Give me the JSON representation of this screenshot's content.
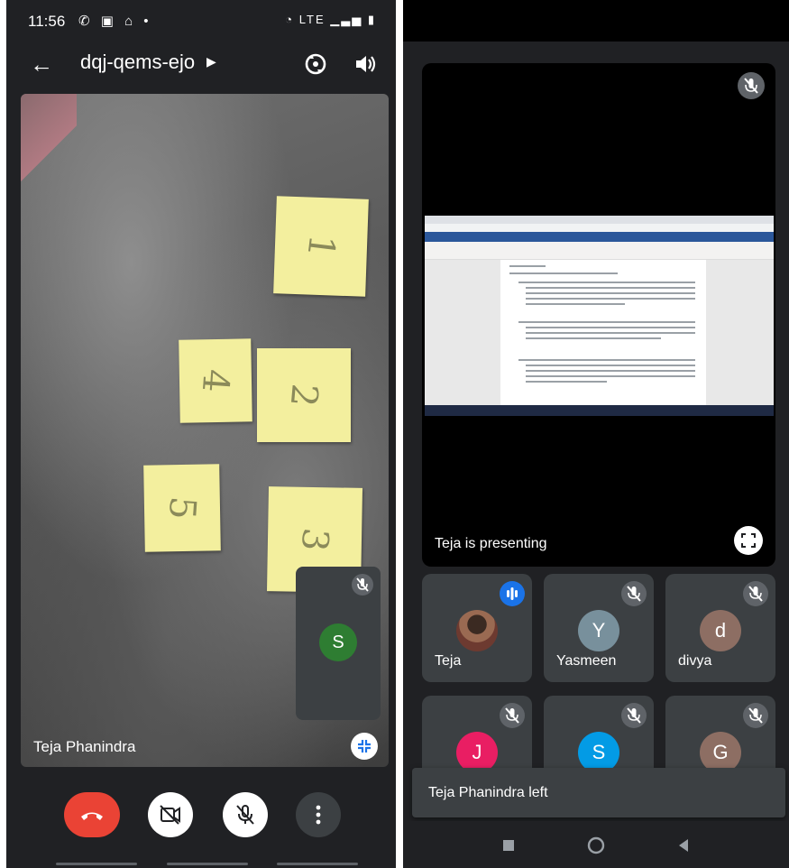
{
  "status_bar": {
    "time": "11:56",
    "icons_left": "✆ ▣ ⌂ •",
    "icons_right": "◔ LTE ▁▃▅ ▮"
  },
  "meeting": {
    "code": "dqj-qems-ejo"
  },
  "main_video": {
    "participant": "Teja Phanindra",
    "notes": [
      "1",
      "4",
      "2",
      "5",
      "3"
    ]
  },
  "self_view": {
    "initial": "S",
    "color": "#2e7d32"
  },
  "presentation": {
    "label": "Teja is presenting"
  },
  "participants": [
    {
      "name": "Teja",
      "initial": "",
      "color": "#8d6e63",
      "speaking": true
    },
    {
      "name": "Yasmeen",
      "initial": "Y",
      "color": "#78909c",
      "speaking": false
    },
    {
      "name": "divya",
      "initial": "d",
      "color": "#8d6e63",
      "speaking": false
    },
    {
      "name": "",
      "initial": "J",
      "color": "#e91e63",
      "speaking": false
    },
    {
      "name": "",
      "initial": "S",
      "color": "#039be5",
      "speaking": false
    },
    {
      "name": "",
      "initial": "G",
      "color": "#8d6e63",
      "speaking": false
    }
  ],
  "toast": {
    "message": "Teja Phanindra left"
  },
  "colors": {
    "end_call": "#ea4335",
    "speaking_indicator": "#1a73e8",
    "tile_bg": "#3c4043"
  }
}
